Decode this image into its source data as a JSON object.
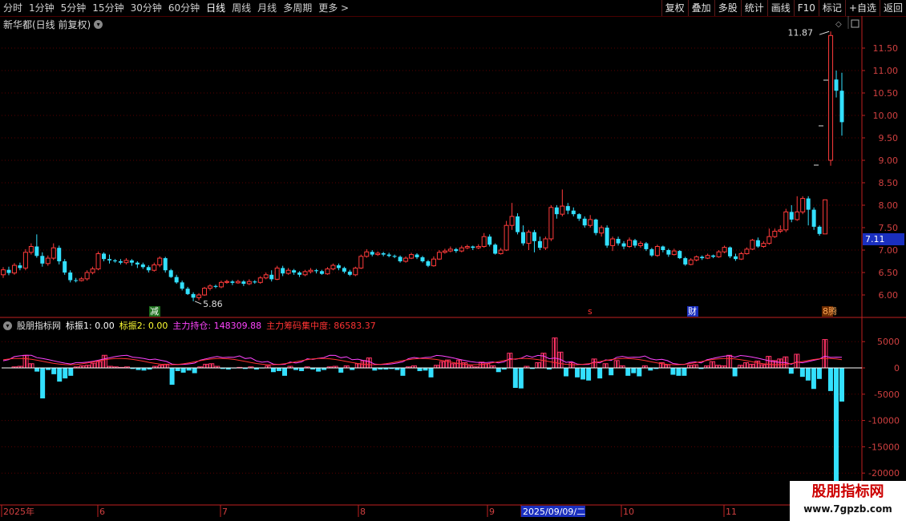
{
  "toolbar": {
    "periods": [
      "分时",
      "1分钟",
      "5分钟",
      "15分钟",
      "30分钟",
      "60分钟",
      "日线",
      "周线",
      "月线",
      "多周期",
      "更多 >"
    ],
    "active": "日线",
    "right_buttons": [
      "复权",
      "叠加",
      "多股",
      "统计",
      "画线",
      "F10",
      "标记",
      "+自选",
      "返回"
    ]
  },
  "stock": {
    "title": "新华都(日线 前复权)"
  },
  "price_axis": {
    "ticks": [
      "11.50",
      "11.00",
      "10.50",
      "10.00",
      "9.50",
      "9.00",
      "8.50",
      "8.00",
      "7.50",
      "7.00",
      "6.50",
      "6.00"
    ],
    "current_price": "7.11",
    "high_label": "11.87",
    "low_label": "5.86"
  },
  "markers": {
    "jian": "减",
    "s": "s",
    "cai": "财",
    "last": "8腾"
  },
  "indicator": {
    "name": "股朋指标网",
    "items": [
      {
        "label": "标振1: 0.00",
        "color": "#ffffff"
      },
      {
        "label": "标振2: 0.00",
        "color": "#ffff33"
      },
      {
        "label": "主力持仓: 148309.88",
        "color": "#ff44ff"
      },
      {
        "label": "主力筹码集中度: 86583.37",
        "color": "#ff3333"
      }
    ],
    "ticks": [
      "5000",
      "0",
      "-5000",
      "-10000",
      "-15000",
      "-20000"
    ]
  },
  "date_axis": {
    "labels": [
      "2025年",
      "6",
      "7",
      "8",
      "9",
      "2025/09/09/二",
      "10",
      "11"
    ]
  },
  "watermark": {
    "line1": "股朋指标网",
    "line2": "www.7gpzb.com"
  },
  "colors": {
    "up": "#ff3b3b",
    "down": "#33e0ff",
    "grid": "#5a0000",
    "axis": "#c02020"
  },
  "chart_data": {
    "type": "candlestick",
    "candles": [
      [
        6.45,
        6.56,
        6.62,
        6.38
      ],
      [
        6.56,
        6.49,
        6.63,
        6.44
      ],
      [
        6.49,
        6.66,
        6.71,
        6.45
      ],
      [
        6.66,
        6.6,
        6.72,
        6.55
      ],
      [
        6.6,
        6.95,
        7.02,
        6.55
      ],
      [
        6.95,
        7.08,
        7.15,
        6.9
      ],
      [
        7.08,
        6.87,
        7.35,
        6.83
      ],
      [
        6.87,
        6.7,
        6.95,
        6.63
      ],
      [
        6.7,
        6.82,
        6.88,
        6.65
      ],
      [
        6.82,
        7.05,
        7.15,
        6.78
      ],
      [
        7.05,
        6.75,
        7.1,
        6.68
      ],
      [
        6.75,
        6.5,
        6.8,
        6.45
      ],
      [
        6.5,
        6.33,
        6.55,
        6.28
      ],
      [
        6.33,
        6.32,
        6.38,
        6.28
      ],
      [
        6.32,
        6.36,
        6.4,
        6.3
      ],
      [
        6.36,
        6.5,
        6.55,
        6.32
      ],
      [
        6.5,
        6.58,
        6.63,
        6.46
      ],
      [
        6.58,
        6.92,
        6.97,
        6.55
      ],
      [
        6.92,
        6.8,
        6.95,
        6.75
      ],
      [
        6.8,
        6.77,
        6.9,
        6.7
      ],
      [
        6.77,
        6.75,
        6.8,
        6.72
      ],
      [
        6.75,
        6.72,
        6.8,
        6.68
      ],
      [
        6.72,
        6.77,
        6.82,
        6.68
      ],
      [
        6.77,
        6.72,
        6.8,
        6.65
      ],
      [
        6.72,
        6.68,
        6.75,
        6.6
      ],
      [
        6.68,
        6.62,
        6.72,
        6.58
      ],
      [
        6.62,
        6.55,
        6.66,
        6.5
      ],
      [
        6.55,
        6.67,
        6.72,
        6.52
      ],
      [
        6.67,
        6.82,
        6.86,
        6.62
      ],
      [
        6.82,
        6.55,
        6.85,
        6.5
      ],
      [
        6.55,
        6.4,
        6.58,
        6.38
      ],
      [
        6.4,
        6.28,
        6.45,
        6.25
      ],
      [
        6.28,
        6.14,
        6.32,
        6.1
      ],
      [
        6.14,
        6.02,
        6.18,
        6.0
      ],
      [
        6.02,
        5.94,
        6.06,
        5.86
      ],
      [
        5.94,
        6.0,
        6.04,
        5.88
      ],
      [
        6.0,
        6.15,
        6.18,
        5.98
      ],
      [
        6.15,
        6.2,
        6.24,
        6.1
      ],
      [
        6.2,
        6.18,
        6.23,
        6.15
      ],
      [
        6.18,
        6.28,
        6.32,
        6.15
      ],
      [
        6.28,
        6.3,
        6.34,
        6.25
      ],
      [
        6.3,
        6.27,
        6.33,
        6.22
      ],
      [
        6.27,
        6.3,
        6.34,
        6.25
      ],
      [
        6.3,
        6.25,
        6.33,
        6.2
      ],
      [
        6.25,
        6.3,
        6.35,
        6.22
      ],
      [
        6.3,
        6.28,
        6.33,
        6.25
      ],
      [
        6.28,
        6.38,
        6.42,
        6.25
      ],
      [
        6.38,
        6.45,
        6.5,
        6.35
      ],
      [
        6.45,
        6.35,
        6.55,
        6.3
      ],
      [
        6.35,
        6.6,
        6.65,
        6.33
      ],
      [
        6.6,
        6.48,
        6.65,
        6.42
      ],
      [
        6.48,
        6.55,
        6.6,
        6.45
      ],
      [
        6.55,
        6.5,
        6.58,
        6.45
      ],
      [
        6.5,
        6.45,
        6.53,
        6.4
      ],
      [
        6.45,
        6.52,
        6.56,
        6.42
      ],
      [
        6.52,
        6.55,
        6.6,
        6.48
      ],
      [
        6.55,
        6.53,
        6.58,
        6.48
      ],
      [
        6.53,
        6.47,
        6.56,
        6.45
      ],
      [
        6.47,
        6.58,
        6.62,
        6.45
      ],
      [
        6.58,
        6.66,
        6.7,
        6.55
      ],
      [
        6.66,
        6.6,
        6.7,
        6.55
      ],
      [
        6.6,
        6.52,
        6.63,
        6.48
      ],
      [
        6.52,
        6.45,
        6.56,
        6.42
      ],
      [
        6.45,
        6.6,
        6.63,
        6.42
      ],
      [
        6.6,
        6.86,
        6.9,
        6.58
      ],
      [
        6.86,
        6.96,
        7.02,
        6.83
      ],
      [
        6.96,
        6.9,
        7.0,
        6.86
      ],
      [
        6.9,
        6.93,
        6.97,
        6.87
      ],
      [
        6.93,
        6.9,
        6.96,
        6.86
      ],
      [
        6.9,
        6.87,
        6.94,
        6.84
      ],
      [
        6.87,
        6.85,
        6.9,
        6.82
      ],
      [
        6.85,
        6.75,
        6.88,
        6.72
      ],
      [
        6.75,
        6.82,
        6.86,
        6.72
      ],
      [
        6.82,
        6.9,
        6.94,
        6.8
      ],
      [
        6.9,
        6.84,
        6.93,
        6.8
      ],
      [
        6.84,
        6.75,
        6.87,
        6.72
      ],
      [
        6.75,
        6.65,
        6.78,
        6.62
      ],
      [
        6.65,
        6.8,
        6.86,
        6.63
      ],
      [
        6.8,
        6.95,
        7.0,
        6.78
      ],
      [
        6.95,
        6.98,
        7.03,
        6.92
      ],
      [
        6.98,
        7.02,
        7.08,
        6.95
      ],
      [
        7.02,
        6.98,
        7.05,
        6.94
      ],
      [
        6.98,
        7.05,
        7.1,
        6.95
      ],
      [
        7.05,
        7.08,
        7.12,
        7.02
      ],
      [
        7.08,
        7.05,
        7.1,
        7.0
      ],
      [
        7.05,
        7.08,
        7.13,
        7.02
      ],
      [
        7.08,
        7.3,
        7.38,
        7.05
      ],
      [
        7.3,
        7.12,
        7.35,
        7.08
      ],
      [
        7.12,
        6.92,
        7.15,
        6.9
      ],
      [
        6.92,
        7.0,
        7.05,
        6.9
      ],
      [
        7.0,
        7.55,
        7.65,
        6.98
      ],
      [
        7.55,
        7.75,
        8.05,
        7.45
      ],
      [
        7.75,
        7.4,
        7.82,
        7.35
      ],
      [
        7.4,
        7.15,
        7.55,
        7.1
      ],
      [
        7.15,
        7.4,
        7.45,
        7.0
      ],
      [
        7.4,
        7.2,
        7.45,
        6.95
      ],
      [
        7.2,
        7.05,
        7.3,
        7.0
      ],
      [
        7.05,
        7.25,
        7.3,
        7.0
      ],
      [
        7.25,
        7.95,
        8.0,
        7.2
      ],
      [
        7.95,
        7.8,
        8.0,
        7.7
      ],
      [
        7.8,
        7.98,
        8.35,
        7.75
      ],
      [
        7.98,
        7.88,
        8.05,
        7.8
      ],
      [
        7.88,
        7.8,
        7.95,
        7.75
      ],
      [
        7.8,
        7.7,
        7.82,
        7.65
      ],
      [
        7.7,
        7.55,
        7.75,
        7.5
      ],
      [
        7.55,
        7.68,
        7.78,
        7.5
      ],
      [
        7.68,
        7.38,
        7.7,
        7.33
      ],
      [
        7.38,
        7.5,
        7.55,
        7.3
      ],
      [
        7.5,
        7.1,
        7.55,
        7.05
      ],
      [
        7.1,
        7.25,
        7.3,
        6.98
      ],
      [
        7.25,
        7.15,
        7.3,
        7.1
      ],
      [
        7.15,
        7.08,
        7.2,
        7.02
      ],
      [
        7.08,
        7.22,
        7.28,
        7.05
      ],
      [
        7.22,
        7.1,
        7.25,
        7.05
      ],
      [
        7.1,
        7.15,
        7.2,
        7.05
      ],
      [
        7.15,
        7.02,
        7.18,
        6.98
      ],
      [
        7.02,
        6.88,
        7.05,
        6.85
      ],
      [
        6.88,
        7.08,
        7.12,
        6.85
      ],
      [
        7.08,
        7.0,
        7.1,
        6.95
      ],
      [
        7.0,
        6.9,
        7.03,
        6.85
      ],
      [
        6.9,
        6.98,
        7.03,
        6.88
      ],
      [
        6.98,
        6.82,
        7.0,
        6.8
      ],
      [
        6.82,
        6.68,
        6.85,
        6.65
      ],
      [
        6.68,
        6.78,
        6.82,
        6.66
      ],
      [
        6.78,
        6.85,
        6.88,
        6.75
      ],
      [
        6.85,
        6.82,
        6.88,
        6.78
      ],
      [
        6.82,
        6.88,
        6.92,
        6.8
      ],
      [
        6.88,
        6.85,
        6.9,
        6.82
      ],
      [
        6.85,
        6.96,
        7.0,
        6.83
      ],
      [
        6.96,
        7.06,
        7.1,
        6.93
      ],
      [
        7.06,
        6.86,
        7.08,
        6.82
      ],
      [
        6.86,
        6.8,
        6.92,
        6.76
      ],
      [
        6.8,
        6.92,
        6.96,
        6.78
      ],
      [
        6.92,
        7.02,
        7.06,
        6.9
      ],
      [
        7.02,
        7.22,
        7.25,
        7.0
      ],
      [
        7.22,
        7.08,
        7.28,
        7.05
      ],
      [
        7.08,
        7.15,
        7.2,
        7.05
      ],
      [
        7.15,
        7.3,
        7.48,
        7.12
      ],
      [
        7.3,
        7.42,
        7.48,
        7.27
      ],
      [
        7.42,
        7.45,
        7.55,
        7.38
      ],
      [
        7.45,
        7.85,
        7.92,
        7.4
      ],
      [
        7.85,
        7.68,
        8.0,
        7.62
      ],
      [
        7.68,
        7.85,
        8.2,
        7.65
      ],
      [
        7.85,
        8.15,
        8.2,
        7.8
      ],
      [
        8.15,
        7.9,
        8.2,
        7.55
      ],
      [
        7.9,
        7.52,
        7.95,
        7.45
      ],
      [
        7.52,
        7.36,
        7.55,
        7.32
      ],
      [
        7.36,
        8.12,
        8.12,
        7.36
      ],
      [
        9.0,
        11.78,
        11.87,
        8.88
      ],
      [
        10.8,
        10.55,
        11.0,
        10.4
      ],
      [
        10.55,
        9.85,
        10.95,
        9.55
      ]
    ],
    "indicator_bars": [
      [
        0,
        0
      ],
      [
        0,
        0
      ],
      [
        0,
        200
      ],
      [
        0,
        300
      ],
      [
        0,
        2400
      ],
      [
        0,
        800
      ],
      [
        -700,
        0
      ],
      [
        -5800,
        0
      ],
      [
        -400,
        0
      ],
      [
        -1200,
        0
      ],
      [
        -2600,
        0
      ],
      [
        -2000,
        0
      ],
      [
        -1500,
        0
      ],
      [
        0,
        200
      ],
      [
        0,
        400
      ],
      [
        0,
        500
      ],
      [
        0,
        900
      ],
      [
        0,
        1200
      ],
      [
        0,
        2400
      ],
      [
        0,
        300
      ],
      [
        0,
        200
      ],
      [
        0,
        100
      ],
      [
        0,
        200
      ],
      [
        -200,
        0
      ],
      [
        -400,
        0
      ],
      [
        -500,
        0
      ],
      [
        -300,
        0
      ],
      [
        0,
        300
      ],
      [
        0,
        500
      ],
      [
        0,
        700
      ],
      [
        -3200,
        0
      ],
      [
        -600,
        0
      ],
      [
        -900,
        0
      ],
      [
        -500,
        0
      ],
      [
        -1000,
        0
      ],
      [
        0,
        200
      ],
      [
        0,
        700
      ],
      [
        0,
        800
      ],
      [
        0,
        300
      ],
      [
        -200,
        0
      ],
      [
        -300,
        0
      ],
      [
        -100,
        0
      ],
      [
        0,
        100
      ],
      [
        -200,
        0
      ],
      [
        0,
        200
      ],
      [
        -300,
        0
      ],
      [
        -100,
        0
      ],
      [
        0,
        400
      ],
      [
        -800,
        0
      ],
      [
        -600,
        0
      ],
      [
        -1500,
        0
      ],
      [
        0,
        300
      ],
      [
        -400,
        0
      ],
      [
        -600,
        0
      ],
      [
        0,
        200
      ],
      [
        -300,
        0
      ],
      [
        -700,
        0
      ],
      [
        -400,
        0
      ],
      [
        0,
        200
      ],
      [
        0,
        300
      ],
      [
        -900,
        0
      ],
      [
        0,
        400
      ],
      [
        -400,
        0
      ],
      [
        0,
        800
      ],
      [
        0,
        1400
      ],
      [
        0,
        1900
      ],
      [
        -500,
        0
      ],
      [
        -300,
        0
      ],
      [
        -300,
        0
      ],
      [
        -200,
        0
      ],
      [
        -400,
        0
      ],
      [
        -1500,
        0
      ],
      [
        0,
        200
      ],
      [
        0,
        400
      ],
      [
        -600,
        0
      ],
      [
        -500,
        0
      ],
      [
        -1800,
        0
      ],
      [
        0,
        500
      ],
      [
        0,
        1200
      ],
      [
        0,
        1500
      ],
      [
        0,
        800
      ],
      [
        0,
        1500
      ],
      [
        0,
        1000
      ],
      [
        0,
        400
      ],
      [
        0,
        200
      ],
      [
        0,
        1100
      ],
      [
        0,
        800
      ],
      [
        0,
        400
      ],
      [
        -800,
        0
      ],
      [
        -300,
        0
      ],
      [
        0,
        2800
      ],
      [
        -3800,
        0
      ],
      [
        -3900,
        0
      ],
      [
        0,
        300
      ],
      [
        -200,
        0
      ],
      [
        0,
        1000
      ],
      [
        0,
        2800
      ],
      [
        -300,
        0
      ],
      [
        0,
        5700
      ],
      [
        0,
        3000
      ],
      [
        -1600,
        0
      ],
      [
        0,
        1000
      ],
      [
        -1800,
        0
      ],
      [
        -2200,
        0
      ],
      [
        -2400,
        0
      ],
      [
        0,
        1700
      ],
      [
        -2000,
        0
      ],
      [
        0,
        800
      ],
      [
        -1400,
        0
      ],
      [
        0,
        1400
      ],
      [
        0,
        400
      ],
      [
        -1500,
        0
      ],
      [
        -1000,
        0
      ],
      [
        -1600,
        0
      ],
      [
        0,
        400
      ],
      [
        -500,
        0
      ],
      [
        -200,
        0
      ],
      [
        0,
        1000
      ],
      [
        0,
        600
      ],
      [
        -1300,
        0
      ],
      [
        -1500,
        0
      ],
      [
        -1500,
        0
      ],
      [
        0,
        500
      ],
      [
        0,
        600
      ],
      [
        -200,
        0
      ],
      [
        0,
        400
      ],
      [
        0,
        1200
      ],
      [
        0,
        500
      ],
      [
        0,
        400
      ],
      [
        0,
        2400
      ],
      [
        -1600,
        0
      ],
      [
        0,
        500
      ],
      [
        0,
        1000
      ],
      [
        0,
        700
      ],
      [
        0,
        1300
      ],
      [
        0,
        600
      ],
      [
        0,
        2200
      ],
      [
        0,
        1400
      ],
      [
        0,
        1700
      ],
      [
        0,
        2100
      ],
      [
        -1100,
        0
      ],
      [
        0,
        2600
      ],
      [
        -1700,
        0
      ],
      [
        -2400,
        0
      ],
      [
        -4000,
        0
      ],
      [
        -2100,
        0
      ],
      [
        0,
        5400
      ],
      [
        -4400,
        0
      ],
      [
        -22000,
        0
      ],
      [
        -6400,
        0
      ]
    ]
  }
}
